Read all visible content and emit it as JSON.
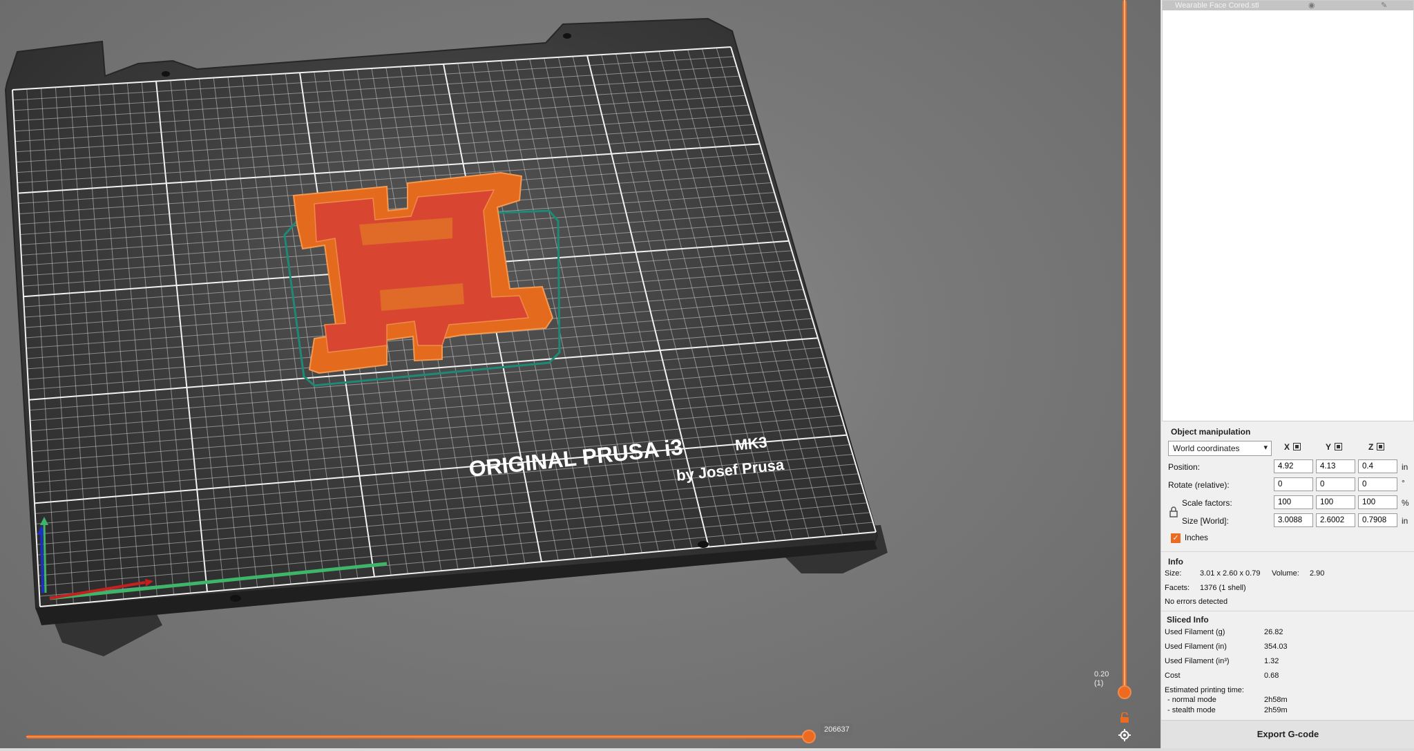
{
  "viewport": {
    "bed_title": "ORIGINAL PRUSA i3",
    "bed_model": "MK3",
    "bed_subtitle": "by Josef Prusa",
    "layer_height": "0.20",
    "layer_index": "(1)",
    "move_count": "206637",
    "accent_color": "#ed6b21"
  },
  "object_list": {
    "items": [
      {
        "name": "Wearable Face Cored.stl"
      }
    ]
  },
  "object_manipulation": {
    "title": "Object manipulation",
    "coordinate_system": "World coordinates",
    "axes": [
      "X",
      "Y",
      "Z"
    ],
    "position": {
      "label": "Position:",
      "x": "4.92",
      "y": "4.13",
      "z": "0.4",
      "unit": "in"
    },
    "rotate": {
      "label": "Rotate (relative):",
      "x": "0",
      "y": "0",
      "z": "0",
      "unit": "°"
    },
    "scale": {
      "label": "Scale factors:",
      "x": "100",
      "y": "100",
      "z": "100",
      "unit": "%"
    },
    "size": {
      "label": "Size [World]:",
      "x": "3.0088",
      "y": "2.6002",
      "z": "0.7908",
      "unit": "in"
    },
    "inches_label": "Inches",
    "inches_checked": true
  },
  "info": {
    "title": "Info",
    "size_label": "Size:",
    "size_value": "3.01 x 2.60 x 0.79",
    "volume_label": "Volume:",
    "volume_value": "2.90",
    "facets_label": "Facets:",
    "facets_value": "1376 (1 shell)",
    "errors": "No errors detected"
  },
  "sliced_info": {
    "title": "Sliced Info",
    "rows": [
      {
        "label": "Used Filament (g)",
        "value": "26.82"
      },
      {
        "label": "Used Filament (in)",
        "value": "354.03"
      },
      {
        "label": "Used Filament (in³)",
        "value": "1.32"
      },
      {
        "label": "Cost",
        "value": "0.68"
      }
    ],
    "time_label": "Estimated printing time:",
    "normal_label": "- normal mode",
    "normal_value": "2h58m",
    "stealth_label": "- stealth mode",
    "stealth_value": "2h59m"
  },
  "export_button": "Export G-code"
}
